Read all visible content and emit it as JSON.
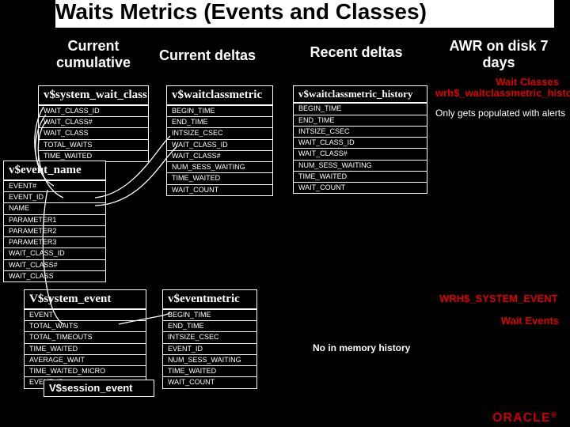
{
  "title": "Waits Metrics (Events and Classes)",
  "columns": {
    "c1": "Current cumulative",
    "c2": "Current deltas",
    "c3": "Recent deltas",
    "c4": "AWR on disk 7 days"
  },
  "section_labels": {
    "wait_classes": "Wait Classes",
    "wait_events": "Wait Events"
  },
  "tables": {
    "system_wait_class": {
      "name": "v$system_wait_class",
      "cols": [
        "WAIT_CLASS_ID",
        "WAIT_CLASS#",
        "WAIT_CLASS",
        "TOTAL_WAITS",
        "TIME_WAITED"
      ]
    },
    "waitclassmetric": {
      "name": "v$waitclassmetric",
      "cols": [
        "BEGIN_TIME",
        "END_TIME",
        "INTSIZE_CSEC",
        "WAIT_CLASS_ID",
        "WAIT_CLASS#",
        "NUM_SESS_WAITING",
        "TIME_WAITED",
        "WAIT_COUNT"
      ]
    },
    "waitclassmetric_history": {
      "name": "v$waitclassmetric_history",
      "cols": [
        "BEGIN_TIME",
        "END_TIME",
        "INTSIZE_CSEC",
        "WAIT_CLASS_ID",
        "WAIT_CLASS#",
        "NUM_SESS_WAITING",
        "TIME_WAITED",
        "WAIT_COUNT"
      ]
    },
    "event_name": {
      "name": "v$event_name",
      "cols": [
        "EVENT#",
        "EVENT_ID",
        "NAME",
        "PARAMETER1",
        "PARAMETER2",
        "PARAMETER3",
        "WAIT_CLASS_ID",
        "WAIT_CLASS#",
        "WAIT_CLASS"
      ]
    },
    "system_event": {
      "name": "V$system_event",
      "cols": [
        "EVENT",
        "TOTAL_WAITS",
        "TOTAL_TIMEOUTS",
        "TIME_WAITED",
        "AVERAGE_WAIT",
        "TIME_WAITED_MICRO",
        "EVENT_ID"
      ]
    },
    "eventmetric": {
      "name": "v$eventmetric",
      "cols": [
        "BEGIN_TIME",
        "END_TIME",
        "INTSIZE_CSEC",
        "EVENT_ID",
        "NUM_SESS_WAITING",
        "TIME_WAITED",
        "WAIT_COUNT"
      ]
    },
    "session_event": {
      "name": "V$session_event"
    }
  },
  "awr": {
    "wrh_waitclass": "wrh$_waitclassmetric_history",
    "wrh_sysevent": "WRH$_SYSTEM_EVENT"
  },
  "notes": {
    "alerts": "Only gets populated with alerts",
    "no_mem": "No in memory history"
  },
  "brand": "ORACLE"
}
